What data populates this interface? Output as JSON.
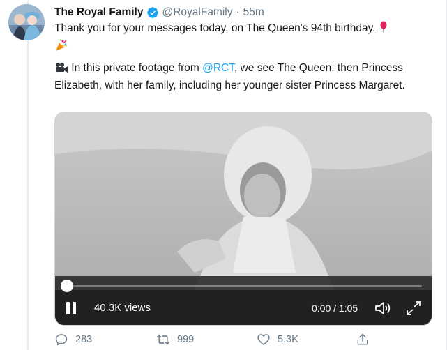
{
  "tweet": {
    "author": {
      "name": "The Royal Family",
      "handle": "@RoyalFamily",
      "verified_icon": "verified-badge-icon"
    },
    "separator": "·",
    "time": "55m",
    "text_line1": "Thank you for your messages today, on The Queen's 94th birthday.",
    "text_line2_prefix": " In this private footage from ",
    "mention": "@RCT",
    "text_line2_suffix": ", we see The Queen, then Princess Elizabeth, with her family, including her younger sister Princess Margaret."
  },
  "video": {
    "views": "40.3K views",
    "timecode": "0:00 / 1:05",
    "progress": 0
  },
  "actions": {
    "replies": "283",
    "retweets": "999",
    "likes": "5.3K"
  },
  "colors": {
    "accent": "#1da1f2",
    "muted": "#657786",
    "border": "#e6ecf0"
  }
}
